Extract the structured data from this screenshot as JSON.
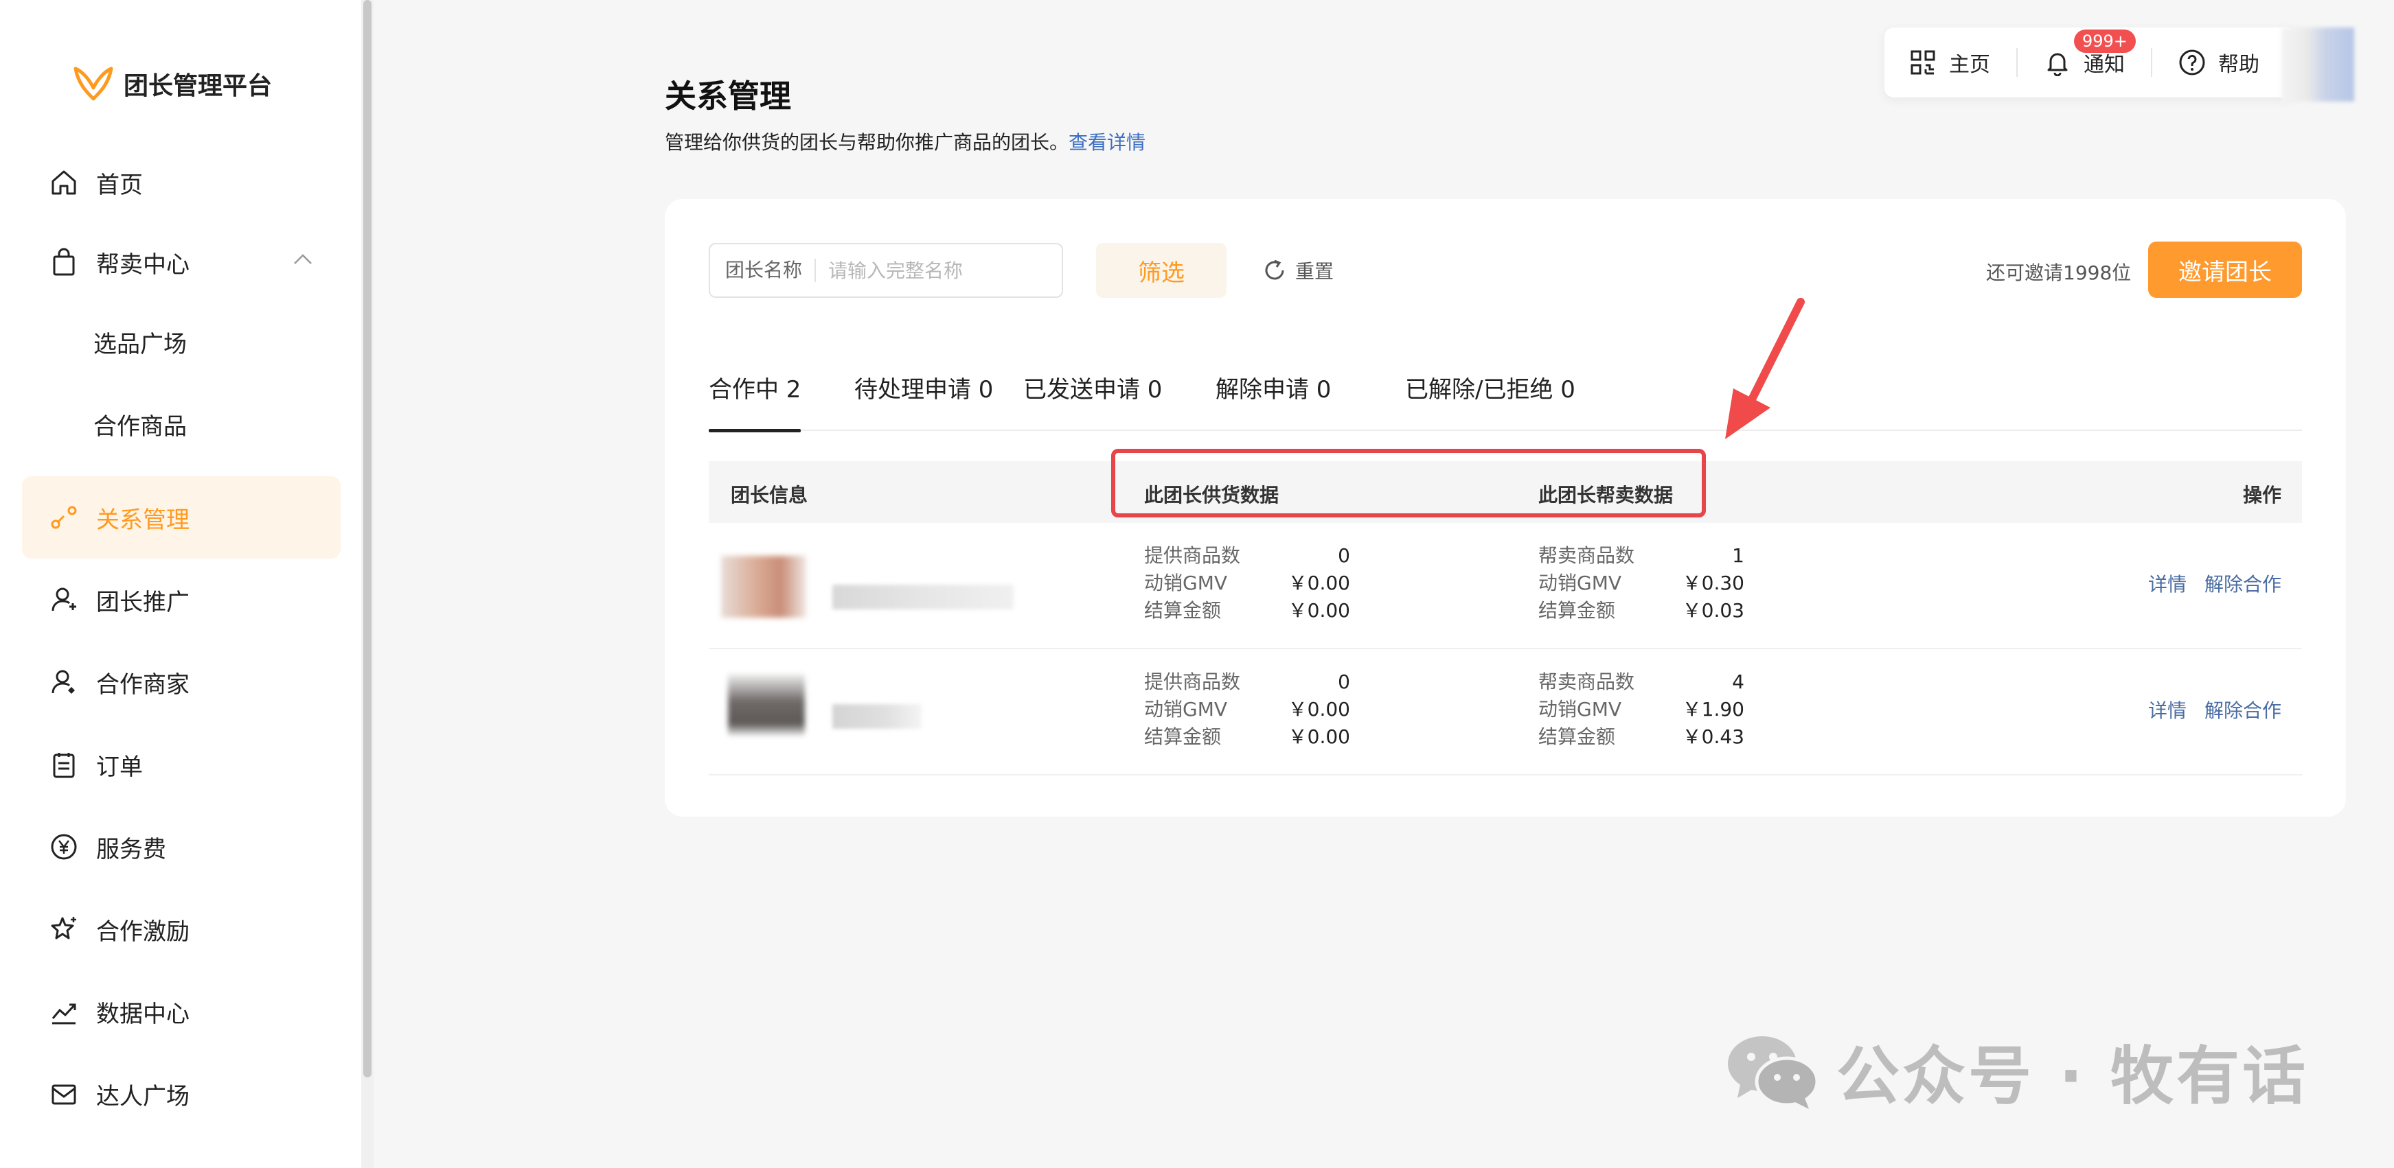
{
  "app": {
    "title": "团长管理平台"
  },
  "sidebar": {
    "items": [
      {
        "label": "首页",
        "icon": "home-icon"
      },
      {
        "label": "帮卖中心",
        "icon": "shopping-bag-icon"
      },
      {
        "label": "选品广场"
      },
      {
        "label": "合作商品"
      },
      {
        "label": "关系管理",
        "icon": "relation-icon",
        "active": true
      },
      {
        "label": "团长推广",
        "icon": "user-promote-icon"
      },
      {
        "label": "合作商家",
        "icon": "user-merchant-icon"
      },
      {
        "label": "订单",
        "icon": "clipboard-icon"
      },
      {
        "label": "服务费",
        "icon": "yen-icon"
      },
      {
        "label": "合作激励",
        "icon": "star-icon"
      },
      {
        "label": "数据中心",
        "icon": "trend-icon"
      },
      {
        "label": "达人广场",
        "icon": "mail-icon"
      }
    ]
  },
  "toolbar": {
    "home_label": "主页",
    "notify_label": "通知",
    "notify_badge": "999+",
    "help_label": "帮助"
  },
  "page": {
    "title": "关系管理",
    "description": "管理给你供货的团长与帮助你推广商品的团长。",
    "detail_link": "查看详情"
  },
  "filters": {
    "name_label": "团长名称",
    "name_placeholder": "请输入完整名称",
    "filter_button": "筛选",
    "reset_button": "重置",
    "invite_remaining": "还可邀请1998位",
    "invite_button": "邀请团长"
  },
  "tabs": [
    {
      "label": "合作中 2",
      "active": true
    },
    {
      "label": "待处理申请 0"
    },
    {
      "label": "已发送申请 0"
    },
    {
      "label": "解除申请 0"
    },
    {
      "label": "已解除/已拒绝 0"
    }
  ],
  "table": {
    "columns": {
      "info": "团长信息",
      "supply": "此团长供货数据",
      "help": "此团长帮卖数据",
      "ops": "操作"
    },
    "rows": [
      {
        "supply": [
          {
            "k": "提供商品数",
            "v": "0"
          },
          {
            "k": "动销GMV",
            "v": "￥0.00"
          },
          {
            "k": "结算金额",
            "v": "￥0.00"
          }
        ],
        "help": [
          {
            "k": "帮卖商品数",
            "v": "1"
          },
          {
            "k": "动销GMV",
            "v": "￥0.30"
          },
          {
            "k": "结算金额",
            "v": "￥0.03"
          }
        ],
        "ops": [
          "详情",
          "解除合作"
        ]
      },
      {
        "supply": [
          {
            "k": "提供商品数",
            "v": "0"
          },
          {
            "k": "动销GMV",
            "v": "￥0.00"
          },
          {
            "k": "结算金额",
            "v": "￥0.00"
          }
        ],
        "help": [
          {
            "k": "帮卖商品数",
            "v": "4"
          },
          {
            "k": "动销GMV",
            "v": "￥1.90"
          },
          {
            "k": "结算金额",
            "v": "￥0.43"
          }
        ],
        "ops": [
          "详情",
          "解除合作"
        ]
      }
    ]
  },
  "watermark": {
    "text": "公众号 · 牧有话"
  },
  "colors": {
    "accent": "#ff9a2e",
    "active_bg": "#fff4e8",
    "link": "#3c6fc2",
    "annotation": "#e8454a"
  }
}
